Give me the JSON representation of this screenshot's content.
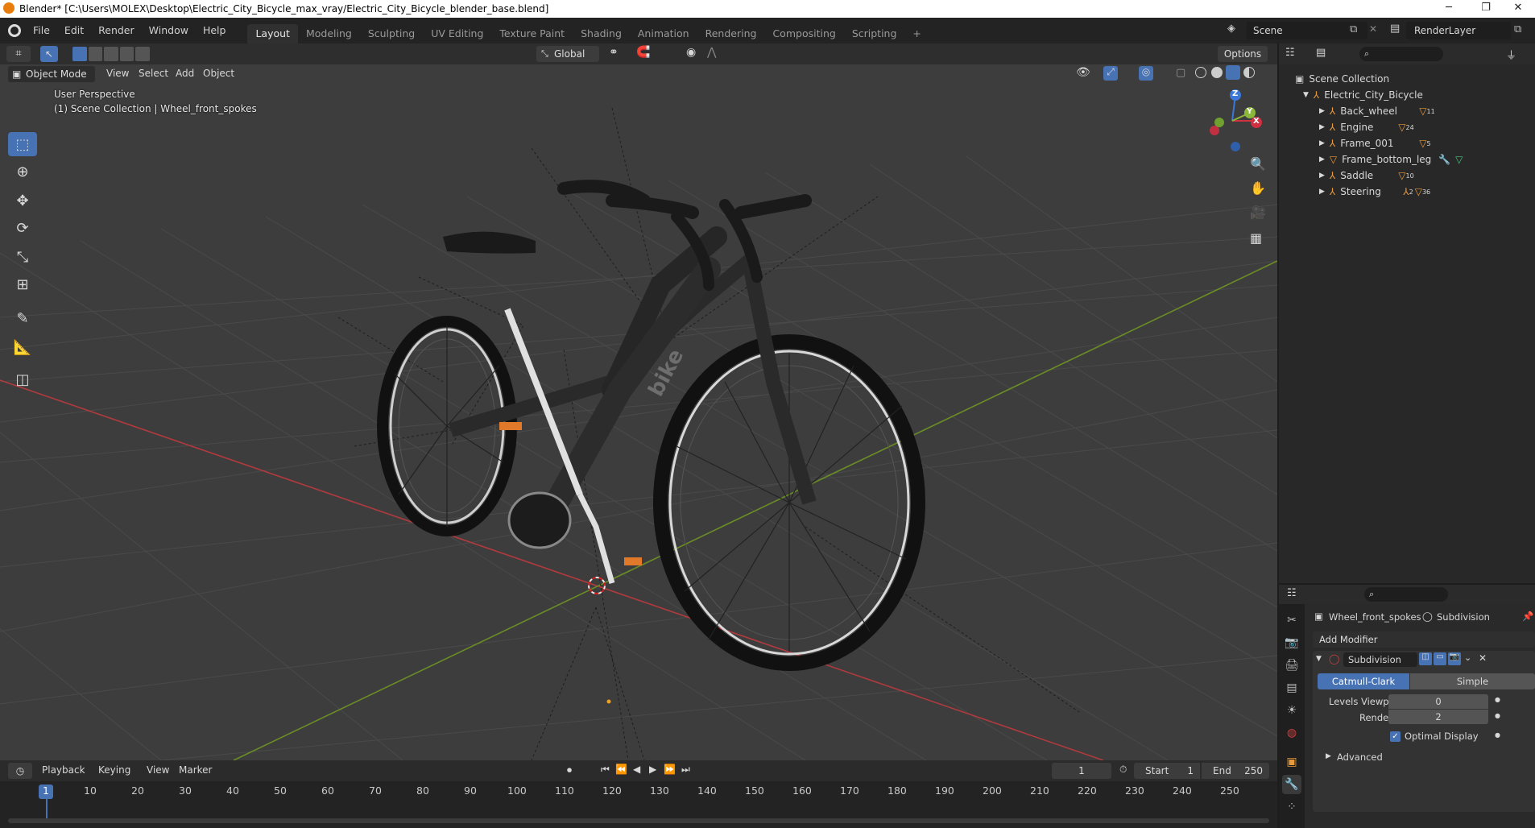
{
  "window": {
    "title": "Blender* [C:\\Users\\MOLEX\\Desktop\\Electric_City_Bicycle_max_vray/Electric_City_Bicycle_blender_base.blend]",
    "minimize": "─",
    "maximize": "❐",
    "close": "✕"
  },
  "menu": [
    "File",
    "Edit",
    "Render",
    "Window",
    "Help"
  ],
  "workspaces": [
    "Layout",
    "Modeling",
    "Sculpting",
    "UV Editing",
    "Texture Paint",
    "Shading",
    "Animation",
    "Rendering",
    "Compositing",
    "Scripting"
  ],
  "workspace_add": "+",
  "scene": {
    "name": "Scene",
    "render_layer": "RenderLayer"
  },
  "viewport_header": {
    "transform_orientation": "Global",
    "options": "Options",
    "mode": "Object Mode",
    "menus": [
      "View",
      "Select",
      "Add",
      "Object"
    ]
  },
  "viewport": {
    "perspective": "User Perspective",
    "collection_info": "(1) Scene Collection | Wheel_front_spokes",
    "brand_text": "bike"
  },
  "gizmo": {
    "x": "X",
    "y": "Y",
    "z": "Z"
  },
  "outliner": {
    "root": "Scene Collection",
    "collection": "Electric_City_Bicycle",
    "items": [
      {
        "name": "Back_wheel",
        "badge": "11"
      },
      {
        "name": "Engine",
        "badge": "24"
      },
      {
        "name": "Frame_001",
        "badge": "5"
      },
      {
        "name": "Frame_bottom_leg",
        "badge": ""
      },
      {
        "name": "Saddle",
        "badge": "10"
      },
      {
        "name": "Steering",
        "badge": "2",
        "badge2": "36"
      }
    ]
  },
  "properties": {
    "object_name": "Wheel_front_spokes",
    "modifier_breadcrumb": "Subdivision",
    "add_modifier": "Add Modifier",
    "modifier_name": "Subdivision",
    "catmull_clark": "Catmull-Clark",
    "simple": "Simple",
    "levels_viewport_label": "Levels Viewport",
    "levels_viewport_value": "0",
    "render_label": "Render",
    "render_value": "2",
    "optimal_display": "Optimal Display",
    "optimal_display_checked": true,
    "advanced": "Advanced"
  },
  "timeline": {
    "menus": [
      "Playback",
      "Keying",
      "View",
      "Marker"
    ],
    "current_frame": "1",
    "start_label": "Start",
    "start_value": "1",
    "end_label": "End",
    "end_value": "250",
    "ticks": [
      "1",
      "10",
      "20",
      "30",
      "40",
      "50",
      "60",
      "70",
      "80",
      "90",
      "100",
      "110",
      "120",
      "130",
      "140",
      "150",
      "160",
      "170",
      "180",
      "190",
      "200",
      "210",
      "220",
      "230",
      "240",
      "250"
    ]
  },
  "colors": {
    "accent": "#4772b3",
    "x_axis": "#b03a3e",
    "y_axis": "#6a8d25",
    "viewport_bg": "#3d3d3d"
  }
}
